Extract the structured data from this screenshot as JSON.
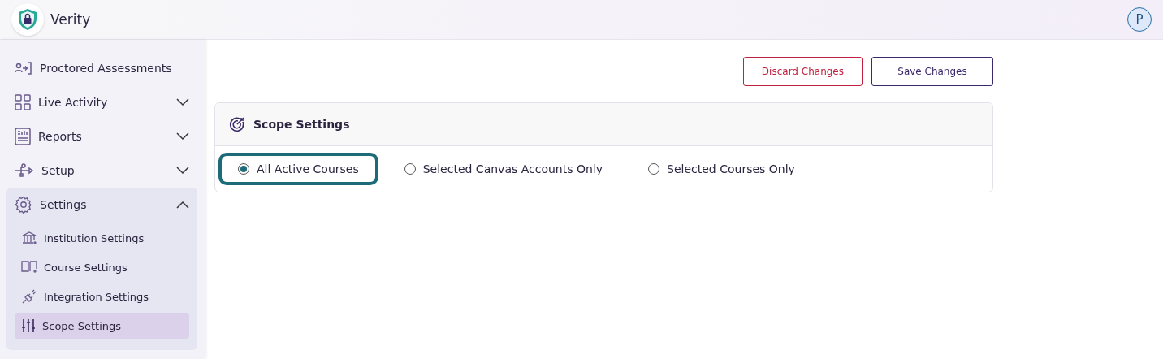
{
  "header": {
    "app_name": "Verity",
    "avatar": "P"
  },
  "sidebar": {
    "items": [
      {
        "label": "Proctored Assessments"
      },
      {
        "label": "Live Activity",
        "expanded": false
      },
      {
        "label": "Reports",
        "expanded": false
      },
      {
        "label": "Setup",
        "expanded": false
      },
      {
        "label": "Settings",
        "expanded": true,
        "children": [
          {
            "label": "Institution Settings",
            "selected": false
          },
          {
            "label": "Course Settings",
            "selected": false
          },
          {
            "label": "Integration Settings",
            "selected": false
          },
          {
            "label": "Scope Settings",
            "selected": true
          }
        ]
      }
    ]
  },
  "actions": [
    {
      "label": "Discard Changes",
      "kind": "danger"
    },
    {
      "label": "Save Changes",
      "kind": "primary"
    }
  ],
  "card": {
    "title": "Scope Settings",
    "options": [
      {
        "label": "All Active Courses",
        "selected": true
      },
      {
        "label": "Selected Canvas Accounts Only",
        "selected": false
      },
      {
        "label": "Selected Courses Only",
        "selected": false
      }
    ]
  }
}
